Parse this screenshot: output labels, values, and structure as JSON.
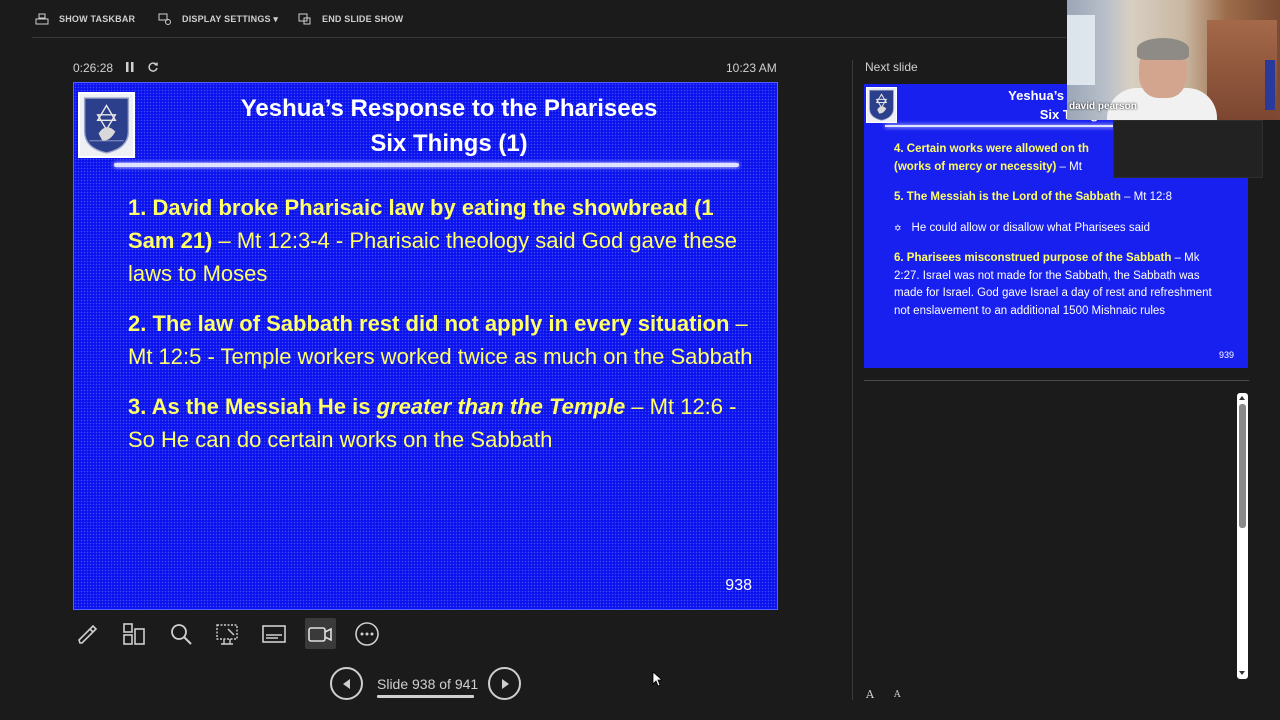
{
  "toolbar": {
    "show_taskbar": "SHOW TASKBAR",
    "display_settings": "DISPLAY SETTINGS ▾",
    "end_slide_show": "END SLIDE SHOW"
  },
  "status": {
    "elapsed": "0:26:28",
    "clock": "10:23 AM"
  },
  "current_slide": {
    "title_line1": "Yeshua’s Response to the Pharisees",
    "title_line2": "Six Things (1)",
    "points": [
      {
        "bold": "1. David broke Pharisaic law by eating the showbread (1 Sam 21)",
        "rest": " – Mt 12:3-4 - Pharisaic theology said God gave these laws to Moses"
      },
      {
        "bold": "2. The law of Sabbath rest did not apply in every situation",
        "rest": " – Mt 12:5 - Temple workers  worked twice as much on the Sabbath"
      },
      {
        "bold": "3. As the Messiah He is ",
        "em": "greater than the Temple",
        "rest": " – Mt 12:6 - So He can do certain works on the Sabbath"
      }
    ],
    "number": "938"
  },
  "navigation": {
    "counter": "Slide 938 of 941"
  },
  "next_slide": {
    "label": "Next slide",
    "title_line1": "Yeshua’s Response",
    "title_line2": "Six Thing",
    "points": [
      {
        "bold": "4. Certain works were allowed on th",
        "bold2": "(works of mercy or necessity)",
        "rest": " – Mt"
      },
      {
        "bold": "5. The Messiah is the Lord of the Sabbath",
        "rest": " – Mt 12:8"
      },
      {
        "bullet": "✡",
        "text": "He could allow or disallow what Pharisees said"
      },
      {
        "bold": "6. Pharisees misconstrued purpose of the Sabbath",
        "rest": " – Mk 2:27. Israel was not made for the Sabbath, the Sabbath was made for Israel. God gave Israel a day of rest and refreshment not enslavement to an additional 1500 Mishnaic rules"
      }
    ],
    "number": "939"
  },
  "font_controls": {
    "increase": "A",
    "decrease": "A"
  },
  "webcam": {
    "participant_name": "david pearson"
  },
  "colors": {
    "slide_blue": "#0a12ee",
    "slide_yellow": "#ffff66",
    "background": "#1b1b1b"
  }
}
